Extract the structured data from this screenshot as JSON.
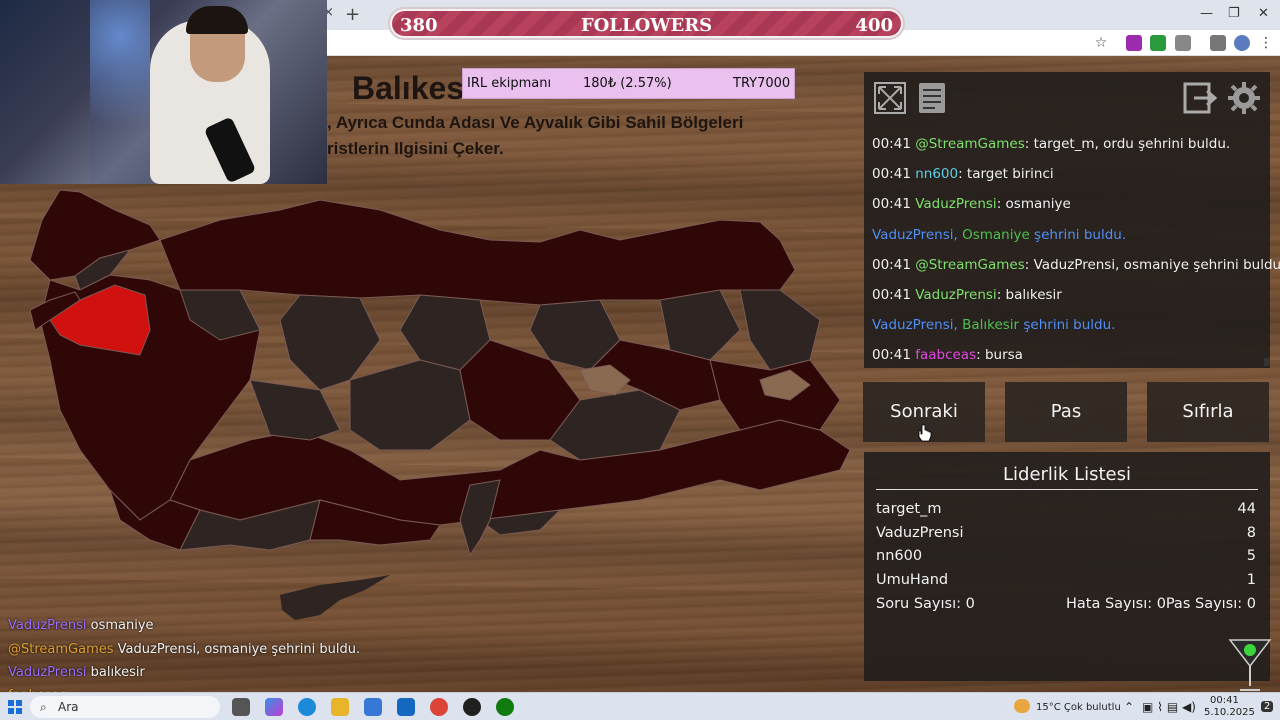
{
  "browser": {
    "new_tab": "+",
    "close": "×",
    "win_min": "—",
    "win_max": "❐",
    "win_close": "✕"
  },
  "followers": {
    "current": "380",
    "label": "FOLLOWERS",
    "goal": "400"
  },
  "quiz": {
    "title": "Balıkesir",
    "line1": ", Ayrıca Cunda Adası Ve Ayvalık Gibi Sahil Bölgeleri",
    "line2": "ristlerin Ilgisini Çeker."
  },
  "irl": {
    "label": "IRL ekipmanı",
    "amount": "180₺ (2.57%)",
    "goal": "TRY7000"
  },
  "chat": [
    {
      "time": "00:41",
      "user": "@StreamGames",
      "user_color": "#7ee06c",
      "text": ": target_m, ordu şehrini buldu."
    },
    {
      "time": "00:41",
      "user": "nn600",
      "user_color": "#5ad0e6",
      "text": ": target birinci"
    },
    {
      "time": "00:41",
      "user": "VaduzPrensi",
      "user_color": "#7ee06c",
      "text": ": osmaniye"
    },
    {
      "time": "",
      "user": "VaduzPrensi,",
      "user_color": "#4f8ff5",
      "city": "Osmaniye",
      "text": " şehrini buldu."
    },
    {
      "time": "00:41",
      "user": "@StreamGames",
      "user_color": "#7ee06c",
      "text": ": VaduzPrensi, osmaniye şehrini buldu."
    },
    {
      "time": "00:41",
      "user": "VaduzPrensi",
      "user_color": "#7ee06c",
      "text": ": balıkesir"
    },
    {
      "time": "",
      "user": "VaduzPrensi,",
      "user_color": "#4f8ff5",
      "city": "Balıkesir",
      "text": " şehrini buldu."
    },
    {
      "time": "00:41",
      "user": "faabceas",
      "user_color": "#e04ae0",
      "text": ": bursa"
    }
  ],
  "buttons": {
    "next": "Sonraki",
    "pass": "Pas",
    "reset": "Sıfırla"
  },
  "leaderboard": {
    "title": "Liderlik Listesi",
    "rows": [
      {
        "name": "target_m",
        "score": "44"
      },
      {
        "name": "VaduzPrensi",
        "score": "8"
      },
      {
        "name": "nn600",
        "score": "5"
      },
      {
        "name": "UmuHand",
        "score": "1"
      }
    ],
    "stats": {
      "questions": "Soru Sayısı: 0",
      "errors": "Hata Sayısı: 0",
      "passes": "Pas Sayısı: 0"
    }
  },
  "overlay_chat": [
    {
      "user": "VaduzPrensi",
      "text": "osmaniye"
    },
    {
      "user": "@StreamGames",
      "text": "VaduzPrensi, osmaniye şehrini buldu."
    },
    {
      "user": "VaduzPrensi",
      "text": "balıkesir"
    },
    {
      "user": "faabceas",
      "text": ""
    }
  ],
  "taskbar": {
    "search": "Ara",
    "weather": "15°C  Çok bulutlu",
    "time": "00:41",
    "date": "5.10.2025",
    "notif": "2"
  },
  "colors": {
    "highlight_city": "#d11010",
    "province_found": "#2e0706",
    "province_unfound": "#2e2522"
  }
}
